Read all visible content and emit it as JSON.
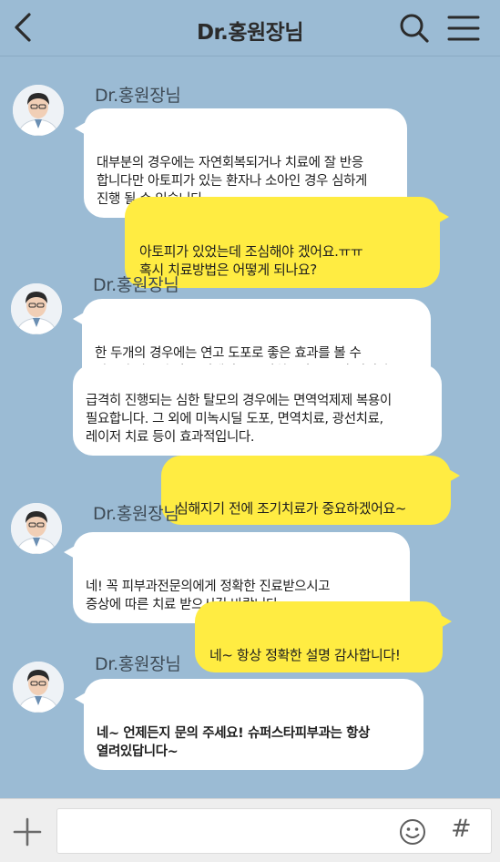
{
  "header": {
    "title": "Dr.홍원장님",
    "back_icon": "chevron-left-icon",
    "search_icon": "search-icon",
    "menu_icon": "hamburger-menu-icon"
  },
  "messages": [
    {
      "type": "sender",
      "name": "Dr.홍원장님"
    },
    {
      "type": "in",
      "text": "대부분의 경우에는 자연회복되거나 치료에 잘 반응\n합니다만 아토피가 있는 환자나 소아인 경우 심하게\n진행 될 수 있습니다."
    },
    {
      "type": "out",
      "text": "아토피가 있었는데 조심해야 겠어요.ㅠㅠ\n혹시 치료방법은 어떻게 되나요?"
    },
    {
      "type": "sender",
      "name": "Dr.홍원장님"
    },
    {
      "type": "in",
      "text": "한 두개의 경우에는 연고 도포로 좋은 효과를 볼 수\n있으며 빠른 효과를 위해서는 주사치료가 도움이 됩니다."
    },
    {
      "type": "in",
      "text": "급격히 진행되는 심한 탈모의 경우에는 면역억제제 복용이\n필요합니다. 그 외에 미녹시딜 도포, 면역치료, 광선치료,\n레이저 치료 등이 효과적입니다."
    },
    {
      "type": "out",
      "text": "심해지기 전에 조기치료가 중요하겠어요~"
    },
    {
      "type": "sender",
      "name": "Dr.홍원장님"
    },
    {
      "type": "in",
      "text": "네! 꼭 피부과전문의에게 정확한 진료받으시고\n증상에 따른 치료 받으시길 바랍니다."
    },
    {
      "type": "out",
      "text": "네~ 항상 정확한 설명 감사합니다!"
    },
    {
      "type": "sender",
      "name": "Dr.홍원장님"
    },
    {
      "type": "in",
      "text": "네~ 언제든지 문의 주세요! 슈퍼스타피부과는 항상\n열려있답니다~"
    }
  ],
  "composer": {
    "plus_icon": "plus-icon",
    "emoji_icon": "emoji-icon",
    "hash_label": "#",
    "input_value": ""
  },
  "colors": {
    "background": "#9bbbd4",
    "incoming_bubble": "#ffffff",
    "outgoing_bubble": "#ffec42"
  }
}
